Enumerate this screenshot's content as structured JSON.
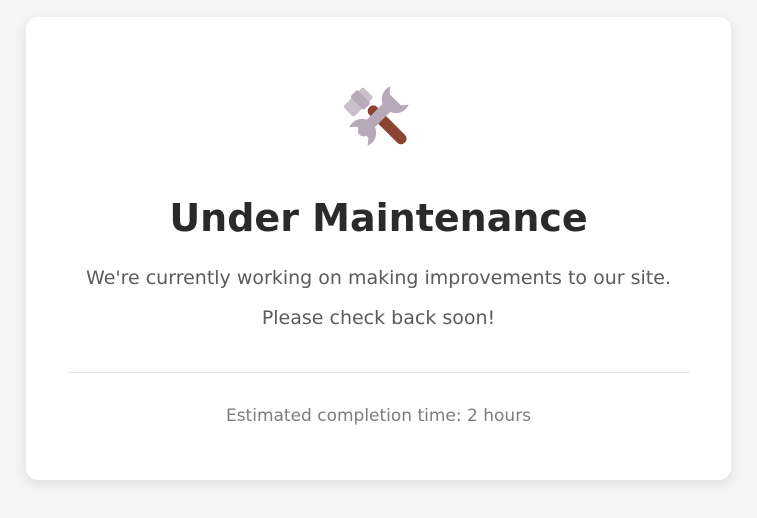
{
  "page": {
    "icon": "hammer-and-wrench-icon",
    "title": "Under Maintenance",
    "message_line1": "We're currently working on making improvements to our site.",
    "message_line2": "Please check back soon!",
    "eta_text": "Estimated completion time: 2 hours"
  },
  "colors": {
    "background": "#f5f5f5",
    "card": "#ffffff",
    "title": "#2a2a2a",
    "text": "#5b5b5b",
    "muted": "#7d7d7d",
    "tool_metal": "#b7a9ba",
    "hammer_handle": "#8a4431"
  }
}
